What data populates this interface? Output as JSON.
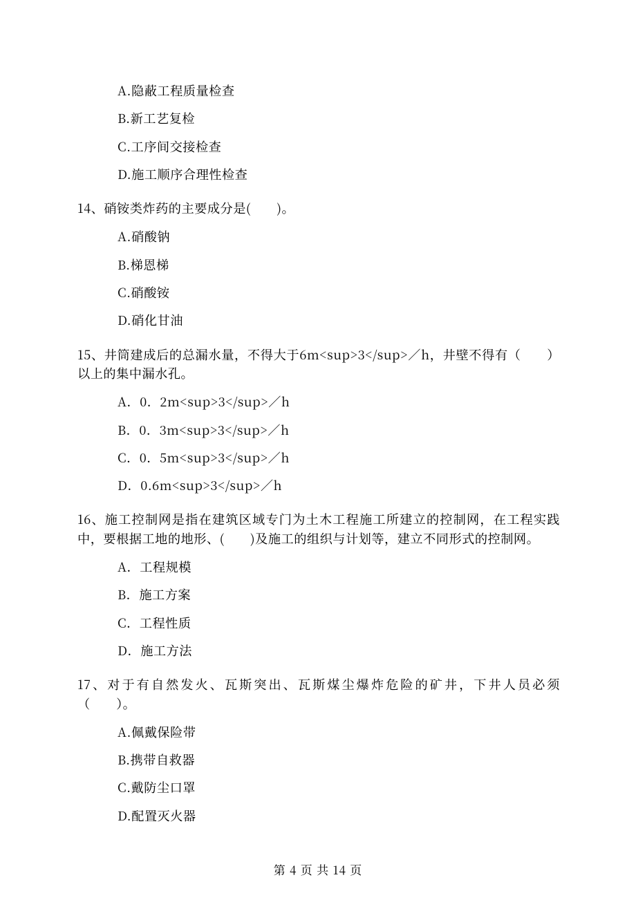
{
  "q13": {
    "options": {
      "a": "A.隐蔽工程质量检查",
      "b": "B.新工艺复检",
      "c": "C.工序间交接检查",
      "d": "D.施工顺序合理性检查"
    }
  },
  "q14": {
    "stem": "14、硝铵类炸药的主要成分是(　　)。",
    "options": {
      "a": "A.硝酸钠",
      "b": "B.梯恩梯",
      "c": "C.硝酸铵",
      "d": "D.硝化甘油"
    }
  },
  "q15": {
    "stem": "15、井筒建成后的总漏水量，不得大于6m<sup>3</sup>／h，井壁不得有（　　）以上的集中漏水孔。",
    "options": {
      "a": "A．0．2m<sup>3</sup>／h",
      "b": "B．0．3m<sup>3</sup>／h",
      "c": "C．0．5m<sup>3</sup>／h",
      "d": "D．0.6m<sup>3</sup>／h"
    }
  },
  "q16": {
    "stem": "16、施工控制网是指在建筑区域专门为土木工程施工所建立的控制网，在工程实践中，要根据工地的地形、(　　)及施工的组织与计划等，建立不同形式的控制网。",
    "options": {
      "a": "A．工程规模",
      "b": "B．施工方案",
      "c": "C．工程性质",
      "d": "D．施工方法"
    }
  },
  "q17": {
    "stem": "17、对于有自然发火、瓦斯突出、瓦斯煤尘爆炸危险的矿井，下井人员必须（　　）。",
    "options": {
      "a": "A.佩戴保险带",
      "b": "B.携带自救器",
      "c": "C.戴防尘口罩",
      "d": "D.配置灭火器"
    }
  },
  "footer": "第 4 页 共 14 页"
}
